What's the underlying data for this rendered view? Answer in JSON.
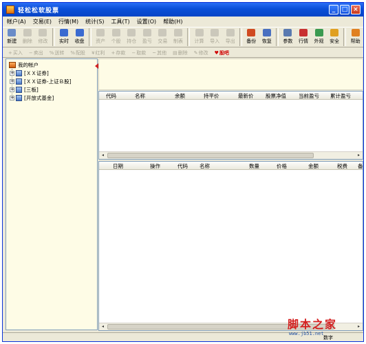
{
  "window": {
    "title": "轻松松软股票"
  },
  "window_buttons": {
    "minimize": "_",
    "maximize": "□",
    "close": "×"
  },
  "menu": [
    {
      "label": "帐户(A)"
    },
    {
      "label": "交易(E)"
    },
    {
      "label": "行情(M)"
    },
    {
      "label": "统计(S)"
    },
    {
      "label": "工具(T)"
    },
    {
      "label": "设置(O)"
    },
    {
      "label": "帮助(H)"
    }
  ],
  "toolbar": [
    {
      "label": "新建",
      "enabled": true,
      "color": "#6a8cc8"
    },
    {
      "label": "删除",
      "enabled": false,
      "color": "#cbc8bb"
    },
    {
      "label": "修改",
      "enabled": false,
      "color": "#cbc8bb"
    },
    {
      "label": "实时",
      "enabled": true,
      "color": "#3a6ad0"
    },
    {
      "label": "收盘",
      "enabled": true,
      "color": "#3a6ad0"
    },
    {
      "label": "资产",
      "enabled": false,
      "color": "#cbc8bb"
    },
    {
      "label": "个股",
      "enabled": false,
      "color": "#cbc8bb"
    },
    {
      "label": "持仓",
      "enabled": false,
      "color": "#cbc8bb"
    },
    {
      "label": "盈亏",
      "enabled": false,
      "color": "#cbc8bb"
    },
    {
      "label": "交易",
      "enabled": false,
      "color": "#cbc8bb"
    },
    {
      "label": "制表",
      "enabled": false,
      "color": "#cbc8bb"
    },
    {
      "label": "计算",
      "enabled": false,
      "color": "#cbc8bb"
    },
    {
      "label": "导入",
      "enabled": false,
      "color": "#cbc8bb"
    },
    {
      "label": "导出",
      "enabled": false,
      "color": "#cbc8bb"
    },
    {
      "label": "备份",
      "enabled": true,
      "color": "#d04a20"
    },
    {
      "label": "恢复",
      "enabled": true,
      "color": "#4a70c0"
    },
    {
      "label": "参数",
      "enabled": true,
      "color": "#5a7ab0"
    },
    {
      "label": "行情",
      "enabled": true,
      "color": "#c83030"
    },
    {
      "label": "外观",
      "enabled": true,
      "color": "#3a9a50"
    },
    {
      "label": "安全",
      "enabled": true,
      "color": "#e0a020"
    },
    {
      "label": "帮助",
      "enabled": true,
      "color": "#e08020"
    }
  ],
  "toolbar2": [
    {
      "glyph": "+",
      "label": "买入",
      "enabled": false
    },
    {
      "glyph": "−",
      "label": "卖出",
      "enabled": false
    },
    {
      "glyph": "%",
      "label": "送转",
      "enabled": false
    },
    {
      "glyph": "%",
      "label": "配股",
      "enabled": false
    },
    {
      "glyph": "¥",
      "label": "红利",
      "enabled": false
    },
    {
      "glyph": "+",
      "label": "存款",
      "enabled": false
    },
    {
      "glyph": "−",
      "label": "取款",
      "enabled": false
    },
    {
      "glyph": "~",
      "label": "其他",
      "enabled": false
    },
    {
      "glyph": "▤",
      "label": "删除",
      "enabled": false
    },
    {
      "glyph": "✎",
      "label": "修改",
      "enabled": false
    },
    {
      "glyph": "♥",
      "label": "股吧",
      "enabled": true
    }
  ],
  "tree": {
    "root": "我的帐户",
    "children": [
      "[ＸＸ证券]",
      "[ＸＸ证券-上证Ｂ股]",
      "[三板]",
      "[开放式基金]"
    ],
    "expander": "+"
  },
  "holdings_table": {
    "columns": [
      "代码",
      "名称",
      "余额",
      "持平价",
      "最新价",
      "股票净值",
      "当前盈亏",
      "累计盈亏"
    ]
  },
  "trades_table": {
    "columns": [
      "日期",
      "操作",
      "代码",
      "名称",
      "数量",
      "价格",
      "金额",
      "税费",
      "备"
    ]
  },
  "scroll": {
    "left": "◂",
    "right": "▸"
  },
  "status": {
    "right_text": "数字"
  },
  "watermark": {
    "text": "脚本之家",
    "url": "www.jb51.net"
  }
}
